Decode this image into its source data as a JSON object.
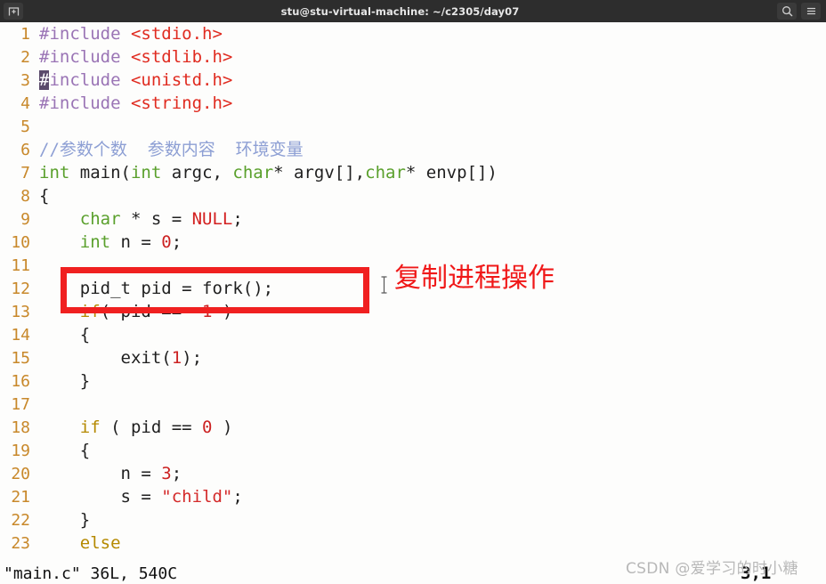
{
  "titlebar": {
    "title": "stu@stu-virtual-machine: ~/c2305/day07",
    "left_button_icon": "new-tab-icon",
    "search_icon": "search-icon",
    "menu_icon": "hamburger-menu-icon"
  },
  "editor": {
    "lines": [
      {
        "n": "1",
        "text": "#include <stdio.h>"
      },
      {
        "n": "2",
        "text": "#include <stdlib.h>"
      },
      {
        "n": "3",
        "text": "#include <unistd.h>"
      },
      {
        "n": "4",
        "text": "#include <string.h>"
      },
      {
        "n": "5",
        "text": ""
      },
      {
        "n": "6",
        "text": "//参数个数  参数内容  环境变量"
      },
      {
        "n": "7",
        "text": "int main(int argc, char* argv[],char* envp[])"
      },
      {
        "n": "8",
        "text": "{"
      },
      {
        "n": "9",
        "text": "    char * s = NULL;"
      },
      {
        "n": "10",
        "text": "    int n = 0;"
      },
      {
        "n": "11",
        "text": ""
      },
      {
        "n": "12",
        "text": "    pid_t pid = fork();"
      },
      {
        "n": "13",
        "text": "    if( pid == -1 )"
      },
      {
        "n": "14",
        "text": "    {"
      },
      {
        "n": "15",
        "text": "        exit(1);"
      },
      {
        "n": "16",
        "text": "    }"
      },
      {
        "n": "17",
        "text": ""
      },
      {
        "n": "18",
        "text": "    if ( pid == 0 )"
      },
      {
        "n": "19",
        "text": "    {"
      },
      {
        "n": "20",
        "text": "        n = 3;"
      },
      {
        "n": "21",
        "text": "        s = \"child\";"
      },
      {
        "n": "22",
        "text": "    }"
      },
      {
        "n": "23",
        "text": "    else"
      }
    ]
  },
  "annotation": {
    "text": "复制进程操作",
    "color": "#f01818",
    "box_color": "#f02020"
  },
  "statusbar": {
    "file_info": "\"main.c\" 36L, 540C",
    "position": "3,1"
  },
  "watermark": {
    "text": "CSDN @爱学习的时小糖"
  },
  "colors": {
    "titlebar_bg": "#2d2d2d",
    "terminal_bg": "#fdfdfc",
    "line_number": "#c8882a",
    "preproc": "#9a74b5",
    "header": "#e02b20",
    "type": "#5aa02c",
    "number": "#cc2222",
    "string": "#d42a2a",
    "comment": "#8d9fd4",
    "keyword": "#b58900"
  }
}
